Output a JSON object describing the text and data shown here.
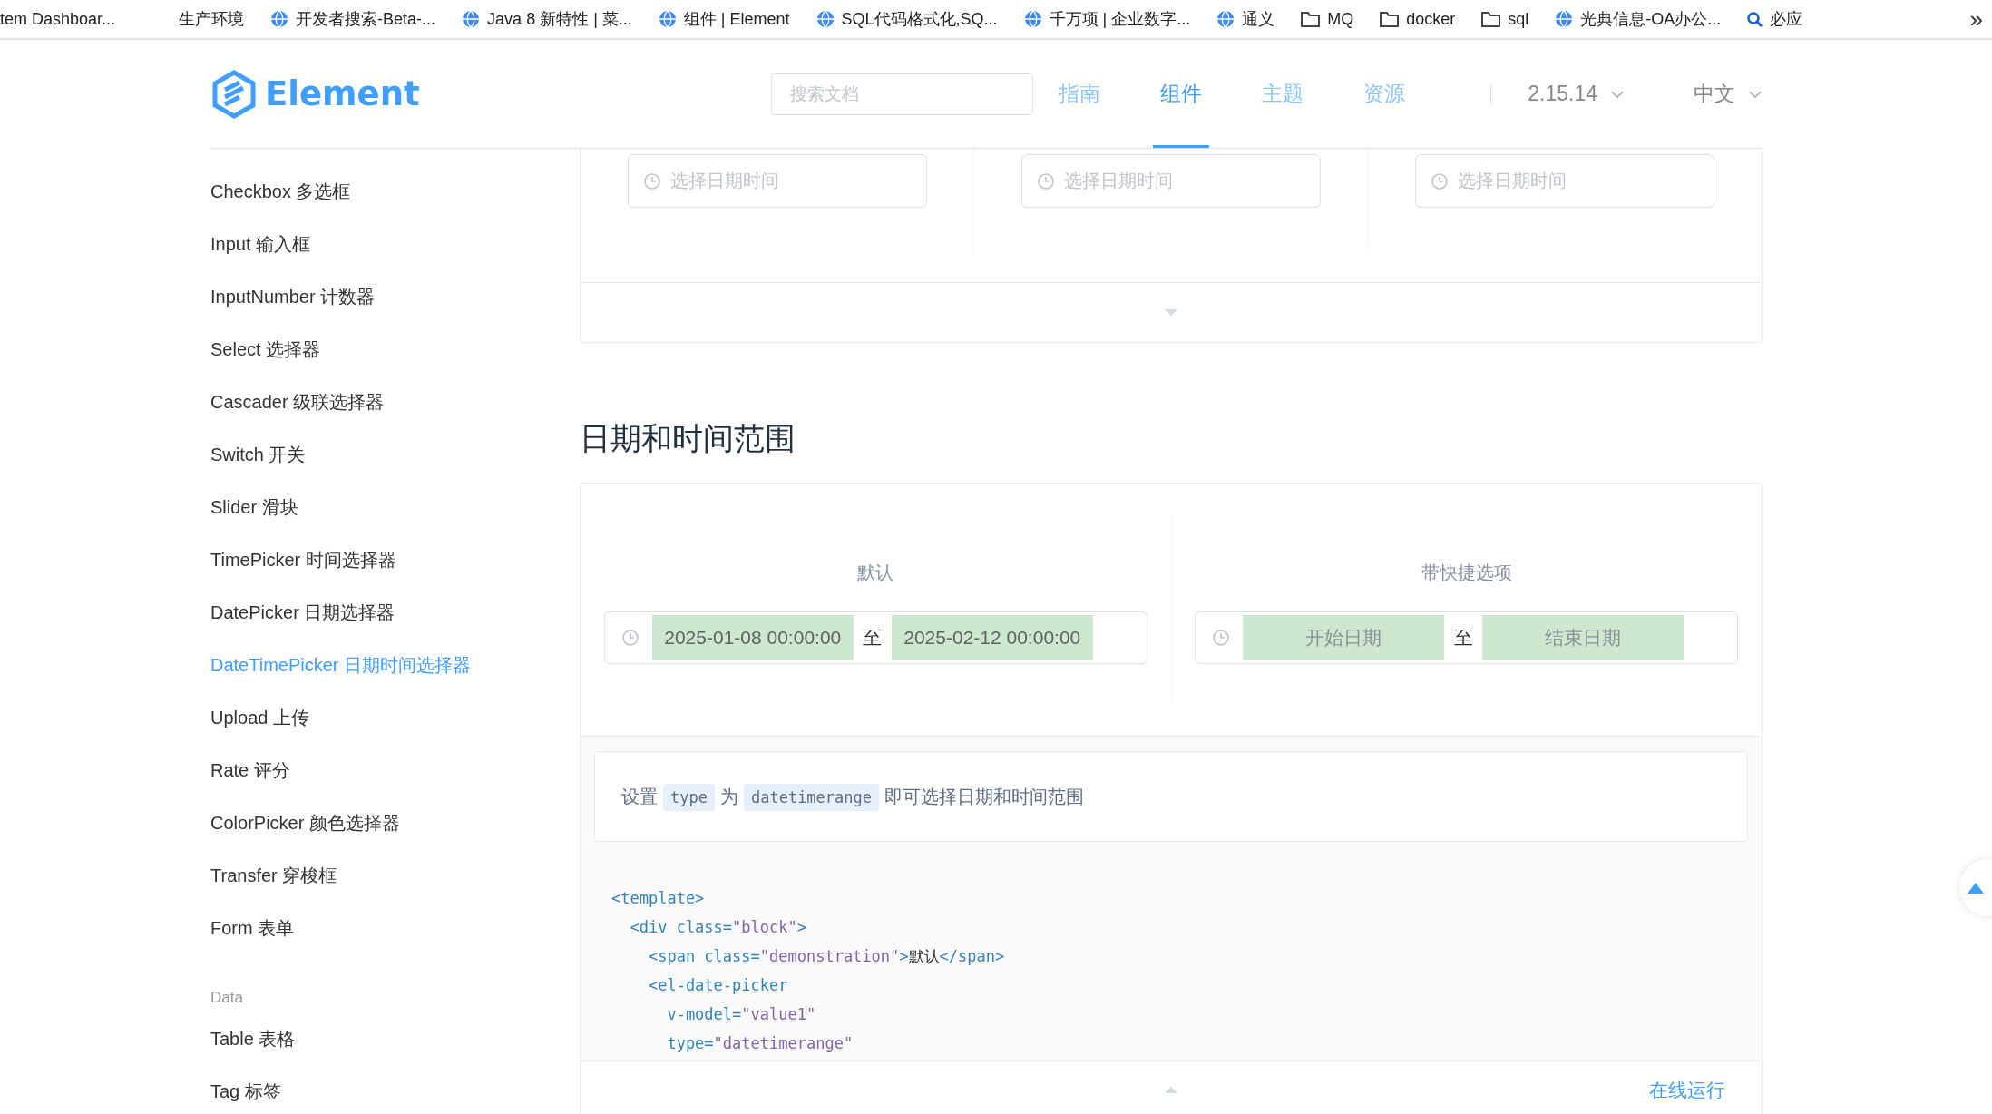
{
  "bookmarks": [
    {
      "label": "tem Dashboar...",
      "kind": "none"
    },
    {
      "label": "生产环境",
      "kind": "none"
    },
    {
      "label": "开发者搜索-Beta-...",
      "kind": "site"
    },
    {
      "label": "Java 8 新特性 | 菜...",
      "kind": "site"
    },
    {
      "label": "组件 | Element",
      "kind": "site"
    },
    {
      "label": "SQL代码格式化,SQ...",
      "kind": "site"
    },
    {
      "label": "千万项 | 企业数字...",
      "kind": "site"
    },
    {
      "label": "通义",
      "kind": "site"
    },
    {
      "label": "MQ",
      "kind": "folder"
    },
    {
      "label": "docker",
      "kind": "folder"
    },
    {
      "label": "sql",
      "kind": "folder"
    },
    {
      "label": "光典信息-OA办公...",
      "kind": "site"
    },
    {
      "label": "必应",
      "kind": "search"
    }
  ],
  "bookmarks_overflow": "»",
  "header": {
    "logo": "Element",
    "search": {
      "placeholder": "搜索文档"
    },
    "nav": [
      {
        "label": "指南",
        "selected": false
      },
      {
        "label": "组件",
        "selected": true
      },
      {
        "label": "主题",
        "selected": false
      },
      {
        "label": "资源",
        "selected": false
      }
    ],
    "version": "2.15.14",
    "language": "中文"
  },
  "sidebar": [
    {
      "label": "Checkbox 多选框",
      "kind": "item",
      "selected": false
    },
    {
      "label": "Input 输入框",
      "kind": "item",
      "selected": false
    },
    {
      "label": "InputNumber 计数器",
      "kind": "item",
      "selected": false
    },
    {
      "label": "Select 选择器",
      "kind": "item",
      "selected": false
    },
    {
      "label": "Cascader 级联选择器",
      "kind": "item",
      "selected": false
    },
    {
      "label": "Switch 开关",
      "kind": "item",
      "selected": false
    },
    {
      "label": "Slider 滑块",
      "kind": "item",
      "selected": false
    },
    {
      "label": "TimePicker 时间选择器",
      "kind": "item",
      "selected": false
    },
    {
      "label": "DatePicker 日期选择器",
      "kind": "item",
      "selected": false
    },
    {
      "label": "DateTimePicker 日期时间选择器",
      "kind": "item",
      "selected": true
    },
    {
      "label": "Upload 上传",
      "kind": "item",
      "selected": false
    },
    {
      "label": "Rate 评分",
      "kind": "item",
      "selected": false
    },
    {
      "label": "ColorPicker 颜色选择器",
      "kind": "item",
      "selected": false
    },
    {
      "label": "Transfer 穿梭框",
      "kind": "item",
      "selected": false
    },
    {
      "label": "Form 表单",
      "kind": "item",
      "selected": false
    },
    {
      "label": "Data",
      "kind": "group"
    },
    {
      "label": "Table 表格",
      "kind": "item",
      "selected": false
    },
    {
      "label": "Tag 标签",
      "kind": "item",
      "selected": false
    }
  ],
  "previous_demo": {
    "pickers": [
      {
        "placeholder": "选择日期时间"
      },
      {
        "placeholder": "选择日期时间"
      },
      {
        "placeholder": "选择日期时间"
      }
    ]
  },
  "section": {
    "title": "日期和时间范围",
    "demos": [
      {
        "label": "默认",
        "start": {
          "value": "2025-01-08 00:00:00"
        },
        "separator": "至",
        "end": {
          "value": "2025-02-12 00:00:00"
        }
      },
      {
        "label": "带快捷选项",
        "start": {
          "placeholder": "开始日期"
        },
        "separator": "至",
        "end": {
          "placeholder": "结束日期"
        }
      }
    ],
    "description": [
      {
        "kind": "text",
        "text": "设置"
      },
      {
        "kind": "code",
        "text": "type"
      },
      {
        "kind": "text",
        "text": "为"
      },
      {
        "kind": "code",
        "text": "datetimerange"
      },
      {
        "kind": "text",
        "text": "即可选择日期和时间范围"
      }
    ],
    "code_lines": [
      [
        {
          "kind": "tag",
          "text": "<template>"
        }
      ],
      [
        {
          "kind": "tag",
          "text": "  <div class="
        },
        {
          "kind": "string",
          "text": "\"block\""
        },
        {
          "kind": "tag",
          "text": ">"
        }
      ],
      [
        {
          "kind": "tag",
          "text": "    <span class="
        },
        {
          "kind": "string",
          "text": "\"demonstration\""
        },
        {
          "kind": "tag",
          "text": ">"
        },
        {
          "kind": "text",
          "text": "默认"
        },
        {
          "kind": "tag",
          "text": "</span>"
        }
      ],
      [
        {
          "kind": "tag",
          "text": "    <el-date-picker"
        }
      ],
      [
        {
          "kind": "tag",
          "text": "      v-model="
        },
        {
          "kind": "string",
          "text": "\"value1\""
        }
      ],
      [
        {
          "kind": "tag",
          "text": "      type="
        },
        {
          "kind": "string",
          "text": "\"datetimerange\""
        }
      ]
    ],
    "run_link": "在线运行"
  }
}
